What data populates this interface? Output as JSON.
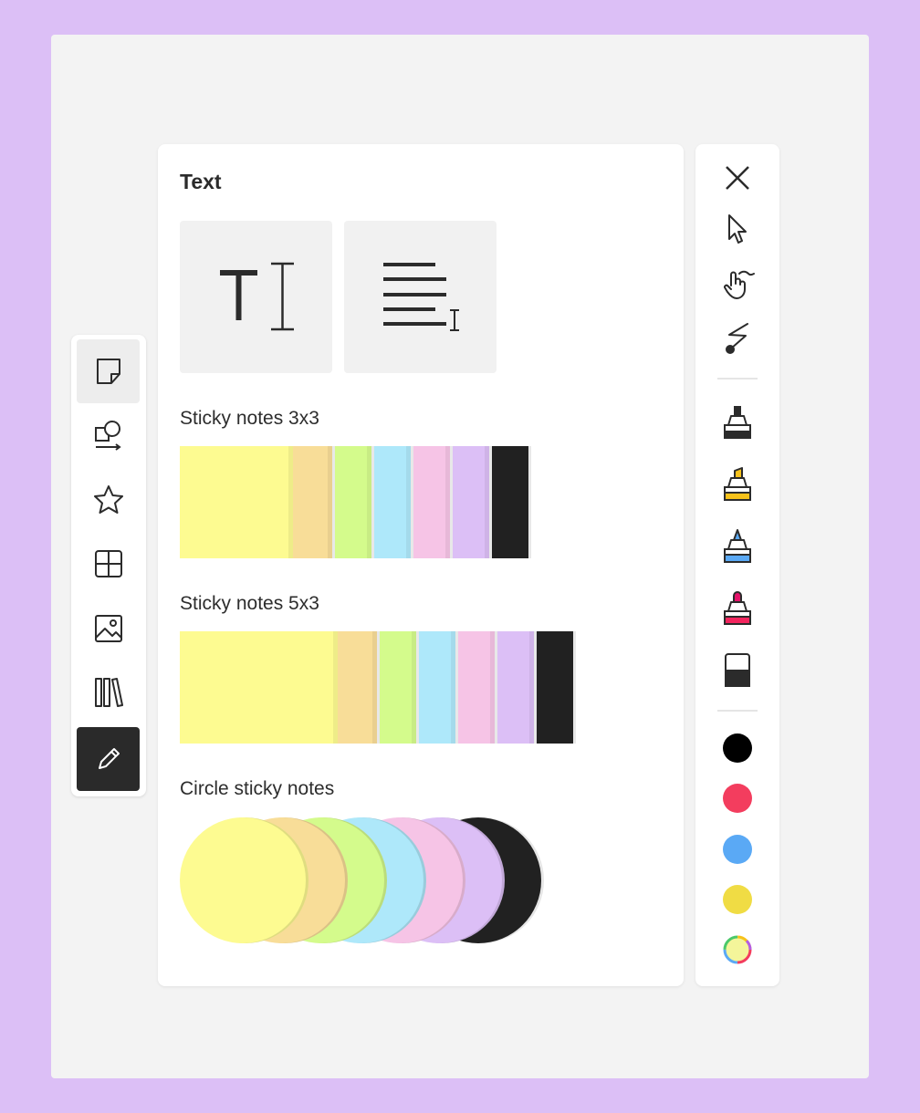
{
  "panel": {
    "title": "Text",
    "text_tools": [
      {
        "icon": "text-cursor-icon"
      },
      {
        "icon": "text-block-icon"
      }
    ],
    "sections": [
      {
        "label": "Sticky notes 3x3",
        "colors": [
          "#fdfb91",
          "#f8dd98",
          "#d4fb8c",
          "#aee8fa",
          "#f6c4e6",
          "#dcbff6",
          "#212121"
        ]
      },
      {
        "label": "Sticky notes 5x3",
        "colors": [
          "#fdfb91",
          "#f8dd98",
          "#d4fb8c",
          "#aee8fa",
          "#f6c4e6",
          "#dcbff6",
          "#212121"
        ]
      },
      {
        "label": "Circle sticky notes",
        "colors": [
          "#fdfb91",
          "#f8dd98",
          "#d4fb8c",
          "#aee8fa",
          "#f6c4e6",
          "#dcbff6",
          "#212121"
        ]
      }
    ]
  },
  "left_toolbar": {
    "items": [
      {
        "icon": "sticky-note-icon",
        "state": "selected"
      },
      {
        "icon": "shapes-icon"
      },
      {
        "icon": "star-icon"
      },
      {
        "icon": "grid-icon"
      },
      {
        "icon": "image-icon"
      },
      {
        "icon": "library-icon"
      },
      {
        "icon": "pencil-icon",
        "state": "active"
      }
    ]
  },
  "right_toolbar": {
    "tools": [
      {
        "icon": "close-icon"
      },
      {
        "icon": "cursor-icon"
      },
      {
        "icon": "pan-hand-icon"
      },
      {
        "icon": "lasso-icon"
      }
    ],
    "pens": [
      {
        "icon": "marker-black-icon",
        "color": "#2b2b2b"
      },
      {
        "icon": "highlighter-yellow-icon",
        "color": "#f7c21b"
      },
      {
        "icon": "pen-blue-icon",
        "color": "#5aa9f5"
      },
      {
        "icon": "pen-pink-icon",
        "color": "#f3255e"
      },
      {
        "icon": "eraser-icon",
        "color": "#2b2b2b"
      }
    ],
    "swatches": [
      {
        "name": "black",
        "color": "#000000"
      },
      {
        "name": "red",
        "color": "#f33d5e"
      },
      {
        "name": "blue",
        "color": "#5aa9f5"
      },
      {
        "name": "yellow",
        "color": "#f0dc44"
      },
      {
        "name": "custom",
        "color": "multicolor"
      }
    ]
  }
}
